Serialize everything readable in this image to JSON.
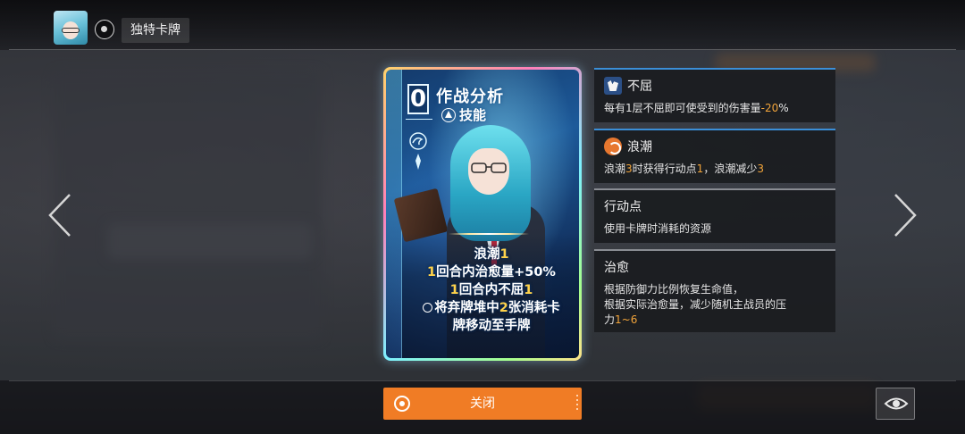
{
  "header": {
    "title": "独特卡牌",
    "avatar_icon": "character-avatar-icon",
    "target_icon": "target-icon"
  },
  "card": {
    "cost": "0",
    "name": "作战分析",
    "type": "技能",
    "description": [
      {
        "parts": [
          {
            "t": "浪潮"
          },
          {
            "t": "1",
            "hl": true
          }
        ]
      },
      {
        "parts": [
          {
            "t": "1",
            "hl": true
          },
          {
            "t": "回合内治愈量+50%"
          }
        ]
      },
      {
        "parts": [
          {
            "t": "1",
            "hl": true
          },
          {
            "t": "回合内不屈"
          },
          {
            "t": "1",
            "hl": true
          }
        ]
      },
      {
        "icon": true,
        "parts": [
          {
            "t": "将弃牌堆中"
          },
          {
            "t": "2",
            "hl": true
          },
          {
            "t": "张消耗卡"
          }
        ]
      },
      {
        "parts": [
          {
            "t": "牌移动至手牌"
          }
        ]
      }
    ]
  },
  "panels": {
    "buqu": {
      "title": "不屈",
      "icon": "muscle-icon",
      "desc_a": "每有1层不屈即可使受到的伤害量",
      "desc_num": "-20",
      "desc_b": "%"
    },
    "langchao": {
      "title": "浪潮",
      "icon": "wave-icon",
      "desc_1": "浪潮",
      "num_1": "3",
      "desc_2": "时获得行动点",
      "num_2": "1",
      "desc_3": "，浪潮减少",
      "num_3": "3"
    },
    "xingdongdian": {
      "title": "行动点",
      "desc": "使用卡牌时消耗的资源"
    },
    "zhiyu": {
      "title": "治愈",
      "line1": "根据防御力比例恢复生命值，",
      "line2": "根据实际治愈量，减少随机主战员的压",
      "line3a": "力",
      "line3num": "1~6"
    }
  },
  "footer": {
    "close_label": "关闭",
    "eye_icon": "eye-icon"
  },
  "colors": {
    "accent_orange": "#f07c25",
    "highlight_yellow": "#ffd24a",
    "number_orange": "#f2a43a",
    "panel_border_blue": "#3b8fd8"
  }
}
